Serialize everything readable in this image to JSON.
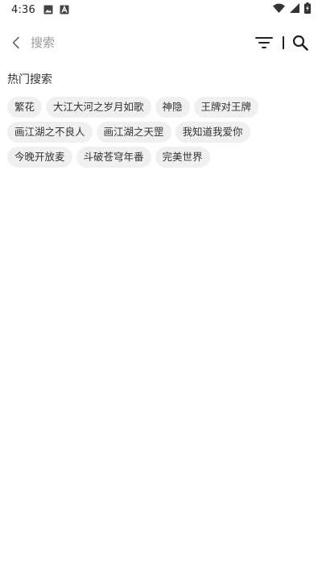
{
  "status_bar": {
    "time": "4:36",
    "icons": [
      "image-icon",
      "font-a-icon",
      "wifi-icon",
      "signal-icon",
      "battery-charging-icon"
    ]
  },
  "search": {
    "placeholder": "搜索",
    "value": ""
  },
  "hot_search": {
    "title": "热门搜索",
    "tags": [
      "繁花",
      "大江大河之岁月如歌",
      "神隐",
      "王牌对王牌",
      "画江湖之不良人",
      "画江湖之天罡",
      "我知道我爱你",
      "今晚开放麦",
      "斗破苍穹年番",
      "完美世界"
    ]
  }
}
